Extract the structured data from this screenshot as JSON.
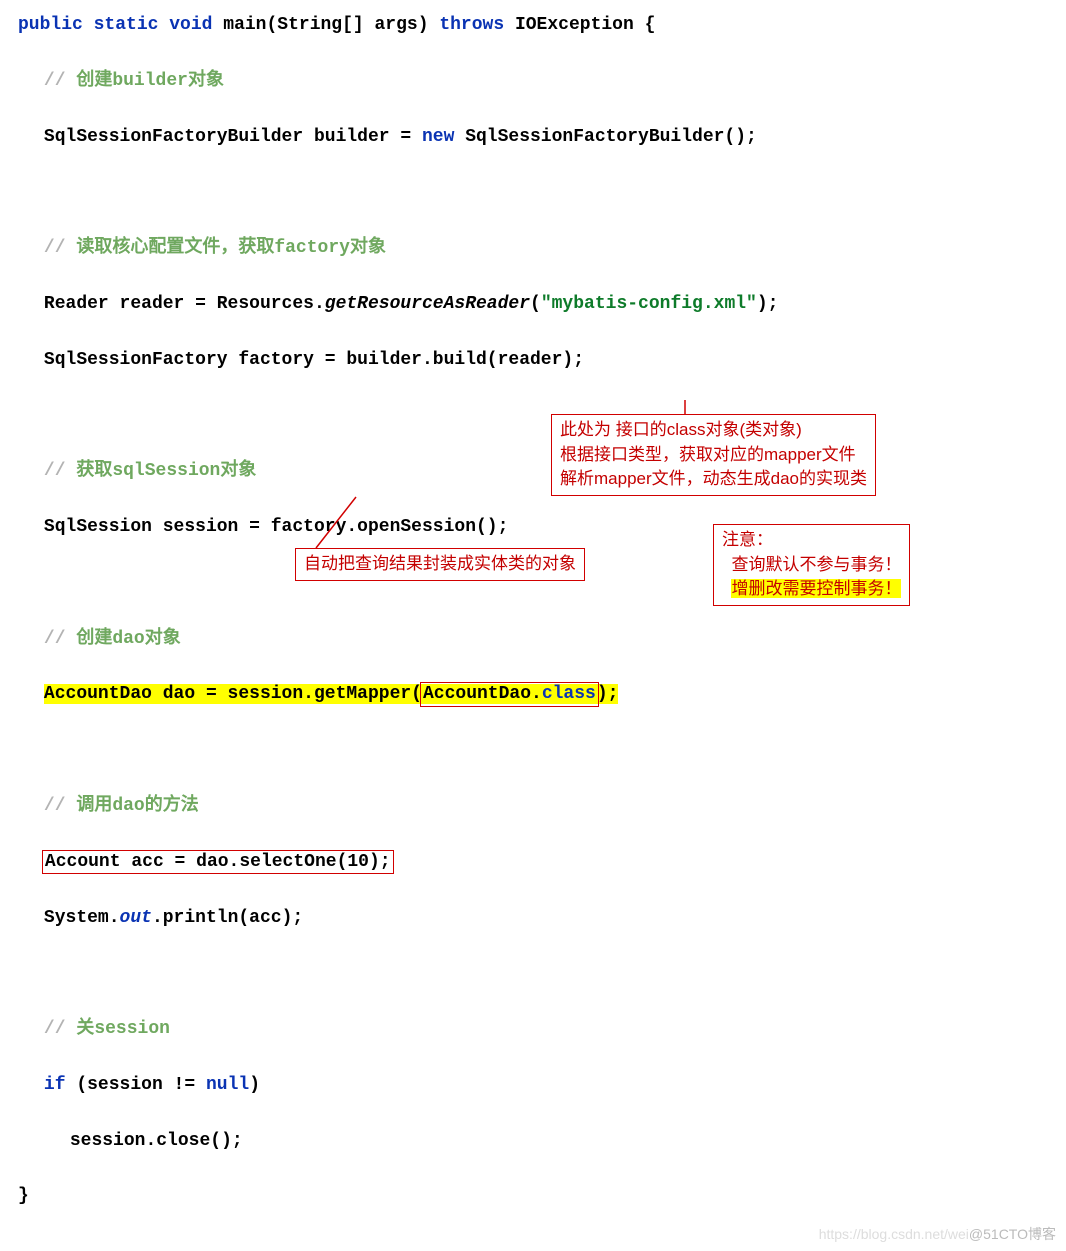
{
  "code": {
    "l1_kw1": "public",
    "l1_kw2": "static",
    "l1_kw3": "void",
    "l1_method": "main(String[] args)",
    "l1_kw4": "throws",
    "l1_ex": "IOException {",
    "c1_slashes": "//",
    "c1_text": " 创建builder对象",
    "l3": "SqlSessionFactoryBuilder builder = ",
    "l3_kw": "new",
    "l3_rest": " SqlSessionFactoryBuilder();",
    "c2_slashes": "//",
    "c2_text": " 读取核心配置文件，获取factory对象",
    "l6a": "Reader reader = Resources.",
    "l6b_it": "getResourceAsReader",
    "l6c": "(",
    "l6_str": "\"mybatis-config.xml\"",
    "l6d": ");",
    "l7": "SqlSessionFactory factory = builder.build(reader);",
    "c3_slashes": "//",
    "c3_text": " 获取sqlSession对象",
    "l10": "SqlSession session = factory.openSession();",
    "c4_slashes": "//",
    "c4_text": " 创建dao对象",
    "l13_pre": "AccountDao dao = session.getMapper(",
    "l13_box_a": "AccountDao",
    "l13_box_dot": ".",
    "l13_box_kw": "class",
    "l13_post": ");",
    "c5_slashes": "//",
    "c5_text": " 调用dao的方法",
    "l16_box": "Account acc = dao.selectOne(10);",
    "l17a": "System.",
    "l17b_it": "out",
    "l17c": ".println(acc);",
    "c6_slashes": "//",
    "c6_text": " 关session",
    "l20_kw_if": "if",
    "l20_mid": " (session != ",
    "l20_kw_null": "null",
    "l20_end": ")",
    "l21": "session.close();",
    "l22": "}"
  },
  "annotations": {
    "a1_line1": "此处为 接口的class对象(类对象)",
    "a1_line2": "根据接口类型，获取对应的mapper文件",
    "a1_line3": "解析mapper文件，动态生成dao的实现类",
    "a2": "自动把查询结果封装成实体类的对象",
    "a3_line1": "注意：",
    "a3_line2": "查询默认不参与事务！",
    "a3_line3": "增删改需要控制事务！"
  },
  "watermark": {
    "faint": "https://blog.csdn.net/wei",
    "main": "@51CTO博客"
  }
}
